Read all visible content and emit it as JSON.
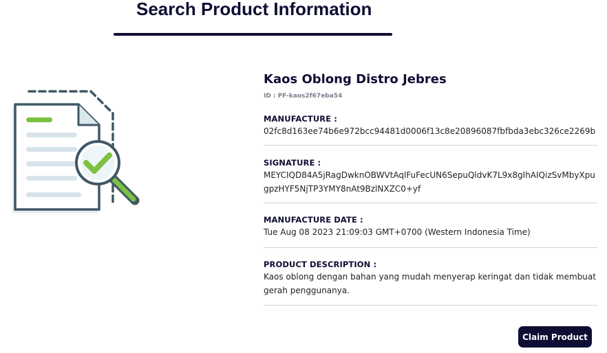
{
  "header": {
    "title": "Search Product Information"
  },
  "product": {
    "name": "Kaos Oblong Distro Jebres",
    "id": "ID : PF-kaos2f67eba54"
  },
  "fields": {
    "manufacture": {
      "label": "MANUFACTURE :",
      "value": "02fc8d163ee74b6e972bcc94481d0006f13c8e20896087fbfbda3ebc326ce2269b"
    },
    "signature": {
      "label": "SIGNATURE :",
      "value": "MEYCIQD84A5jRagDwknOBWVtAqlFuFecUN6SepuQldvK7L9x8gIhAIQizSvMbyXpugpzHYF5NjTP3YMY8nAt9BzlNXZC0+yf"
    },
    "manufacture_date": {
      "label": "MANUFACTURE DATE :",
      "value": "Tue Aug 08 2023 21:09:03 GMT+0700 (Western Indonesia Time)"
    },
    "description": {
      "label": "PRODUCT DESCRIPTION :",
      "value": "Kaos oblong dengan bahan yang mudah menyerap keringat dan tidak membuat gerah penggunanya."
    }
  },
  "actions": {
    "claim_label": "Claim Product"
  },
  "icons": {
    "illustration": "document-search-check-icon"
  },
  "colors": {
    "primary": "#0e0d33",
    "accent_green": "#7cc142",
    "divider": "#cfd3d8"
  }
}
